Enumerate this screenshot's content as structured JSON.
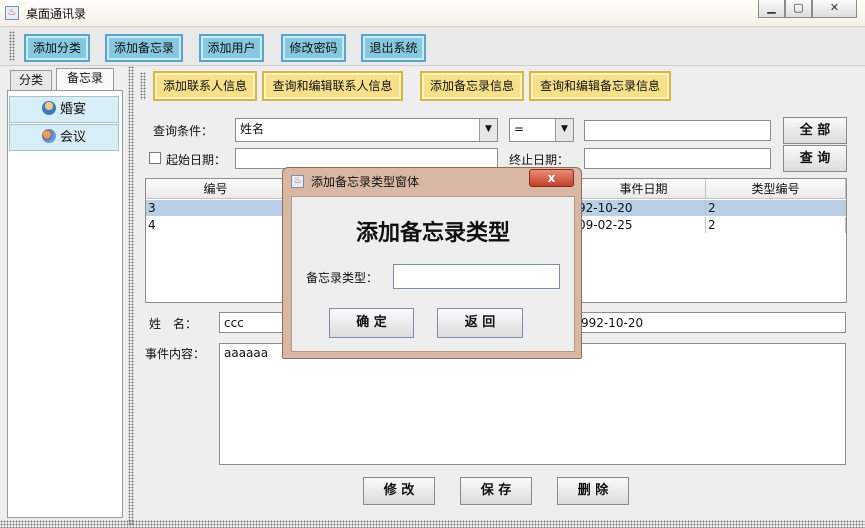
{
  "window": {
    "title": "桌面通讯录",
    "controls": [
      "▁",
      "▢",
      "✕"
    ]
  },
  "toolbar": {
    "buttons": [
      "添加分类",
      "添加备忘录",
      "添加用户",
      "修改密码",
      "退出系统"
    ]
  },
  "left_tabs": [
    "分类",
    "备忘录"
  ],
  "tree": {
    "items": [
      {
        "label": "婚宴",
        "icon": "person-icon"
      },
      {
        "label": "会议",
        "icon": "group-icon"
      }
    ]
  },
  "subtoolbar": {
    "buttons": [
      "添加联系人信息",
      "查询和编辑联系人信息",
      "添加备忘录信息",
      "查询和编辑备忘录信息"
    ]
  },
  "query": {
    "condition_label": "查询条件：",
    "condition_value": "姓名",
    "operator_value": "=",
    "query_value": "",
    "all_button": "全 部",
    "start_date_label": "起始日期：",
    "start_date_value": "",
    "end_date_label": "终止日期：",
    "end_date_value": "",
    "search_button": "查 询"
  },
  "table": {
    "columns": [
      "编号",
      "",
      "",
      "事件日期",
      "类型编号"
    ],
    "rows": [
      {
        "id": "3",
        "date": "92-10-20",
        "type": "2",
        "selected": true
      },
      {
        "id": "4",
        "date": "09-02-25",
        "type": "2",
        "selected": false
      }
    ]
  },
  "detail": {
    "name_label": "姓　名：",
    "name_value": "ccc",
    "date_value": "992-10-20",
    "content_label": "事件内容：",
    "content_value": "aaaaaa"
  },
  "bottom_buttons": [
    "修 改",
    "保 存",
    "删 除"
  ],
  "dialog": {
    "title": "添加备忘录类型窗体",
    "heading": "添加备忘录类型",
    "field_label": "备忘录类型：",
    "field_value": "",
    "ok_button": "确 定",
    "back_button": "返 回",
    "close_label": "x"
  }
}
